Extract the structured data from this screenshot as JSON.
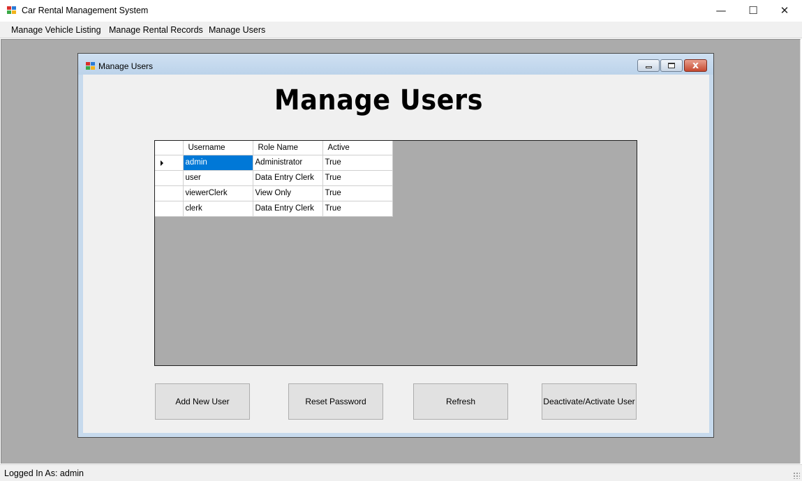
{
  "app": {
    "title": "Car Rental Management System",
    "window_controls": {
      "minimize": "—",
      "maximize": "☐",
      "close": "✕"
    }
  },
  "menu": {
    "items": [
      {
        "label": "Manage Vehicle Listing"
      },
      {
        "label": "Manage Rental Records"
      },
      {
        "label": "Manage Users"
      }
    ]
  },
  "child_window": {
    "title": "Manage Users",
    "close_glyph": "x"
  },
  "page": {
    "heading": "Manage Users"
  },
  "users_grid": {
    "columns": [
      "Username",
      "Role Name",
      "Active"
    ],
    "rows": [
      {
        "username": "admin",
        "role": "Administrator",
        "active": "True"
      },
      {
        "username": "user",
        "role": "Data Entry Clerk",
        "active": "True"
      },
      {
        "username": "viewerClerk",
        "role": "View Only",
        "active": "True"
      },
      {
        "username": "clerk",
        "role": "Data Entry Clerk",
        "active": "True"
      }
    ],
    "selected_row": 0
  },
  "buttons": {
    "add_new_user": "Add New User",
    "reset_password": "Reset Password",
    "refresh": "Refresh",
    "deactivate_activate": "Deactivate/Activate User"
  },
  "status": {
    "logged_in": "Logged In As: admin"
  },
  "colors": {
    "selection": "#0078d7",
    "mdi_background": "#ababab",
    "client_background": "#f0f0f0"
  }
}
